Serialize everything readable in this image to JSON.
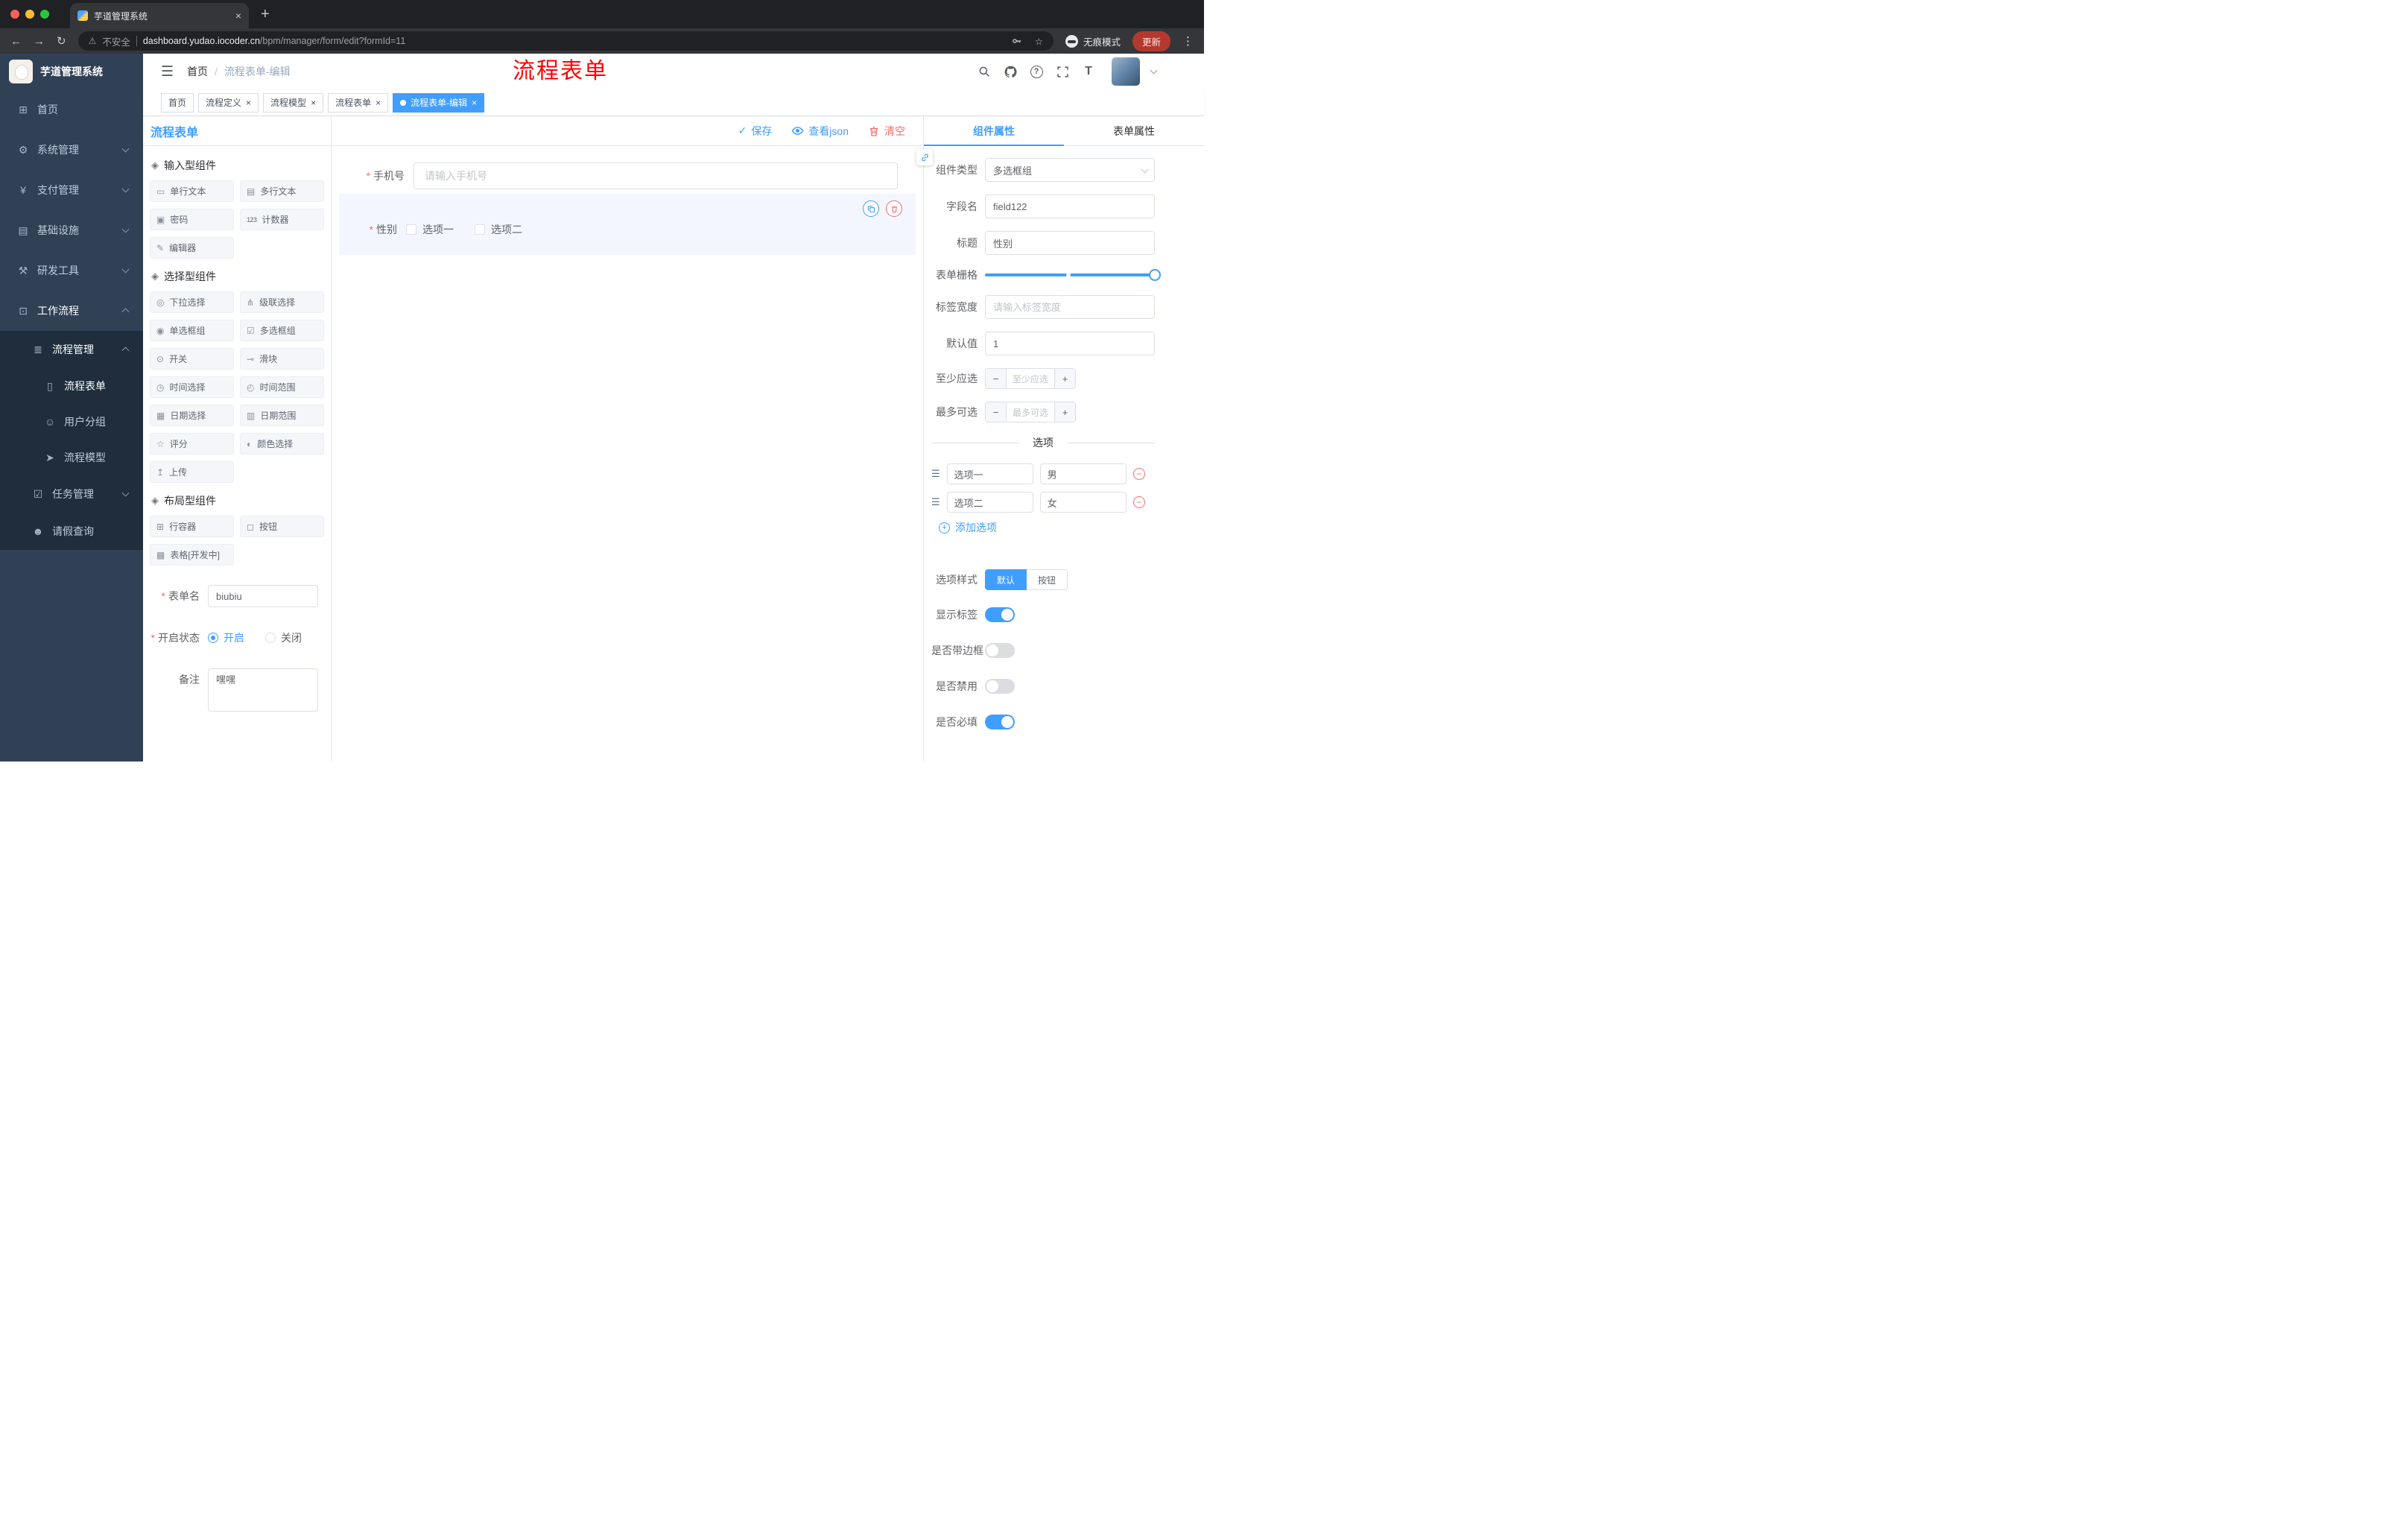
{
  "icons": {
    "back": "←",
    "forward": "→",
    "reload": "↻",
    "warning": "⚠",
    "star": "☆",
    "kebab": "⋮",
    "hamburger": "☰",
    "close": "×",
    "plus": "+",
    "minus": "−",
    "check": "✓",
    "question": "?",
    "fontsize": "T",
    "drag": "☰"
  },
  "colors": {
    "primary": "#409eff",
    "danger": "#f56c6c",
    "annotation": "#ff0000"
  },
  "browser": {
    "tab": {
      "title": "芋道管理系统"
    },
    "address": {
      "security_label": "不安全",
      "url_host": "dashboard.yudao.iocoder.cn",
      "url_path": "/bpm/manager/form/edit?formId=11",
      "incognito_label": "无痕模式",
      "update_label": "更新"
    }
  },
  "sidebar": {
    "logo_title": "芋道管理系统",
    "menu": [
      {
        "label": "首页",
        "icon": "dashboard-icon",
        "glyph": "⊞",
        "level": 1
      },
      {
        "label": "系统管理",
        "icon": "system-management-icon",
        "glyph": "⚙",
        "level": 1,
        "chevron": "down"
      },
      {
        "label": "支付管理",
        "icon": "payment-management-icon",
        "glyph": "¥",
        "level": 1,
        "chevron": "down"
      },
      {
        "label": "基础设施",
        "icon": "infrastructure-icon",
        "glyph": "▤",
        "level": 1,
        "chevron": "down"
      },
      {
        "label": "研发工具",
        "icon": "devtools-icon",
        "glyph": "⚒",
        "level": 1,
        "chevron": "down"
      },
      {
        "label": "工作流程",
        "icon": "workflow-icon",
        "glyph": "⊡",
        "level": 1,
        "chevron": "up",
        "active": true
      },
      {
        "label": "流程管理",
        "icon": "process-management-icon",
        "glyph": "≣",
        "level": 2,
        "chevron": "up",
        "sub": true,
        "active": true
      },
      {
        "label": "流程表单",
        "icon": "process-form-icon",
        "glyph": "▯",
        "level": 3,
        "sub": true,
        "active": true
      },
      {
        "label": "用户分组",
        "icon": "user-group-icon",
        "glyph": "☺",
        "level": 3,
        "sub": true
      },
      {
        "label": "流程模型",
        "icon": "process-model-icon",
        "glyph": "➤",
        "level": 3,
        "sub": true
      },
      {
        "label": "任务管理",
        "icon": "task-management-icon",
        "glyph": "☑",
        "level": 2,
        "chevron": "down",
        "sub": true
      },
      {
        "label": "请假查询",
        "icon": "leave-query-icon",
        "glyph": "☻",
        "level": 2,
        "sub": true
      }
    ]
  },
  "header": {
    "breadcrumb": [
      "首页",
      "流程表单-编辑"
    ],
    "breadcrumb_separator": "/",
    "annotation": "流程表单"
  },
  "tags": [
    {
      "label": "首页",
      "closable": false,
      "active": false
    },
    {
      "label": "流程定义",
      "closable": true,
      "active": false
    },
    {
      "label": "流程模型",
      "closable": true,
      "active": false
    },
    {
      "label": "流程表单",
      "closable": true,
      "active": false
    },
    {
      "label": "流程表单-编辑",
      "closable": true,
      "active": true
    }
  ],
  "designer": {
    "title": "流程表单",
    "toolbar": {
      "save": "保存",
      "view_json": "查看json",
      "clear": "清空"
    },
    "palette": [
      {
        "title": "输入型组件",
        "icon_glyph": "◈",
        "items": [
          {
            "label": "单行文本",
            "icon": "single-line-text-icon",
            "glyph": "▭"
          },
          {
            "label": "多行文本",
            "icon": "multi-line-text-icon",
            "glyph": "▤"
          },
          {
            "label": "密码",
            "icon": "password-icon",
            "glyph": "▣"
          },
          {
            "label": "计数器",
            "icon": "counter-icon",
            "glyph": "123"
          },
          {
            "label": "编辑器",
            "icon": "editor-icon",
            "glyph": "✎"
          }
        ]
      },
      {
        "title": "选择型组件",
        "icon_glyph": "◈",
        "items": [
          {
            "label": "下拉选择",
            "icon": "select-icon",
            "glyph": "◎"
          },
          {
            "label": "级联选择",
            "icon": "cascader-icon",
            "glyph": "⋔"
          },
          {
            "label": "单选框组",
            "icon": "radio-group-icon",
            "glyph": "◉"
          },
          {
            "label": "多选框组",
            "icon": "checkbox-group-icon",
            "glyph": "☑"
          },
          {
            "label": "开关",
            "icon": "switch-icon",
            "glyph": "⊙"
          },
          {
            "label": "滑块",
            "icon": "slider-icon",
            "glyph": "⊸"
          },
          {
            "label": "时间选择",
            "icon": "time-picker-icon",
            "glyph": "◷"
          },
          {
            "label": "时间范围",
            "icon": "time-range-icon",
            "glyph": "◴"
          },
          {
            "label": "日期选择",
            "icon": "date-picker-icon",
            "glyph": "▦"
          },
          {
            "label": "日期范围",
            "icon": "date-range-icon",
            "glyph": "▥"
          },
          {
            "label": "评分",
            "icon": "rate-icon",
            "glyph": "☆"
          },
          {
            "label": "颜色选择",
            "icon": "color-picker-icon",
            "glyph": "◐"
          },
          {
            "label": "上传",
            "icon": "upload-icon",
            "glyph": "↥"
          }
        ]
      },
      {
        "title": "布局型组件",
        "icon_glyph": "◈",
        "items": [
          {
            "label": "行容器",
            "icon": "row-container-icon",
            "glyph": "⊞"
          },
          {
            "label": "按钮",
            "icon": "button-icon",
            "glyph": "◻"
          },
          {
            "label": "表格[开发中]",
            "icon": "table-icon",
            "glyph": "▩"
          }
        ]
      }
    ],
    "meta_form": {
      "name_label": "表单名",
      "name_value": "biubiu",
      "status_label": "开启状态",
      "status_options": [
        "开启",
        "关闭"
      ],
      "status_selected": "开启",
      "remark_label": "备注",
      "remark_value": "嘿嘿"
    },
    "canvas": {
      "phone_field": {
        "label": "手机号",
        "placeholder": "请输入手机号",
        "required": true
      },
      "gender_field": {
        "label": "性别",
        "required": true,
        "options": [
          "选项一",
          "选项二"
        ]
      }
    }
  },
  "properties": {
    "tabs": [
      "组件属性",
      "表单属性"
    ],
    "active_tab": "组件属性",
    "component_type_label": "组件类型",
    "component_type_value": "多选框组",
    "field_name_label": "字段名",
    "field_name_value": "field122",
    "title_label": "标题",
    "title_value": "性别",
    "grid_label": "表单栅格",
    "label_width_label": "标签宽度",
    "label_width_placeholder": "请输入标签宽度",
    "default_value_label": "默认值",
    "default_value": "1",
    "min_select_label": "至少应选",
    "min_select_placeholder": "至少应选",
    "max_select_label": "最多可选",
    "max_select_placeholder": "最多可选",
    "options_title": "选项",
    "options": [
      {
        "label": "选项一",
        "value": "男"
      },
      {
        "label": "选项二",
        "value": "女"
      }
    ],
    "add_option_label": "添加选项",
    "option_style_label": "选项样式",
    "option_style_choices": [
      "默认",
      "按钮"
    ],
    "option_style_selected": "默认",
    "switches": [
      {
        "label": "显示标签",
        "on": true
      },
      {
        "label": "是否带边框",
        "on": false
      },
      {
        "label": "是否禁用",
        "on": false
      },
      {
        "label": "是否必填",
        "on": true
      }
    ]
  }
}
